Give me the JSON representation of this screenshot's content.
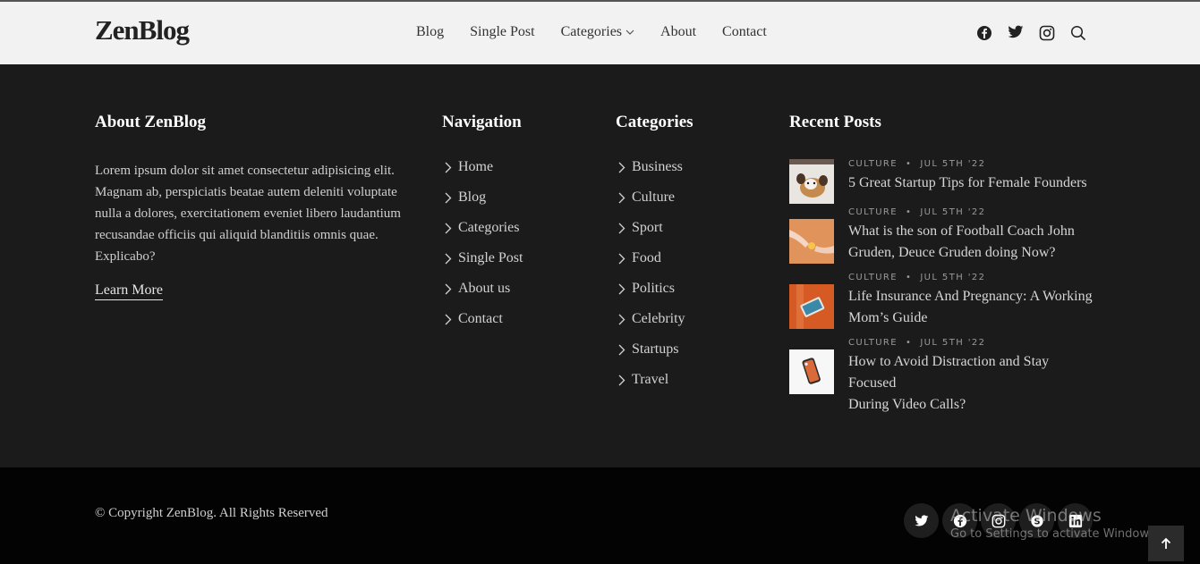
{
  "header": {
    "logo": "ZenBlog",
    "nav": [
      {
        "label": "Blog"
      },
      {
        "label": "Single Post"
      },
      {
        "label": "Categories"
      },
      {
        "label": "About"
      },
      {
        "label": "Contact"
      }
    ],
    "icons": [
      "facebook-icon",
      "twitter-icon",
      "instagram-icon",
      "search-icon"
    ]
  },
  "footer": {
    "about": {
      "title": "About ZenBlog",
      "text_lines": [
        "Lorem ipsum dolor sit amet consectetur adipisicing elit.",
        "Magnam ab, perspiciatis beatae autem deleniti voluptate",
        "nulla a dolores, exercitationem eveniet libero laudantium",
        "recusandae officiis qui aliquid blanditiis omnis quae.",
        "Explicabo?"
      ],
      "learn_more": "Learn More"
    },
    "navigation": {
      "title": "Navigation",
      "items": [
        "Home",
        "Blog",
        "Categories",
        "Single Post",
        "About us",
        "Contact"
      ]
    },
    "categories": {
      "title": "Categories",
      "items": [
        "Business",
        "Culture",
        "Sport",
        "Food",
        "Politics",
        "Celebrity",
        "Startups",
        "Travel"
      ]
    },
    "recent_posts": {
      "title": "Recent Posts",
      "posts": [
        {
          "category": "CULTURE",
          "date": "JUL 5TH '22",
          "title_lines": [
            "5 Great Startup Tips for Female Founders"
          ]
        },
        {
          "category": "CULTURE",
          "date": "JUL 5TH '22",
          "title_lines": [
            "What is the son of Football Coach John",
            "Gruden, Deuce Gruden doing Now?"
          ]
        },
        {
          "category": "CULTURE",
          "date": "JUL 5TH '22",
          "title_lines": [
            "Life Insurance And Pregnancy: A Working",
            "Mom’s Guide"
          ]
        },
        {
          "category": "CULTURE",
          "date": "JUL 5TH '22",
          "title_lines": [
            "How to Avoid Distraction and Stay Focused",
            "During Video Calls?"
          ]
        }
      ]
    }
  },
  "bottom": {
    "copyright": "© Copyright ZenBlog. All Rights Reserved",
    "social_icons": [
      "twitter-icon",
      "facebook-icon",
      "instagram-icon",
      "skype-icon",
      "linkedin-icon"
    ],
    "watermark_line1": "Activate Windows",
    "watermark_line2": "Go to Settings to activate Windows."
  }
}
